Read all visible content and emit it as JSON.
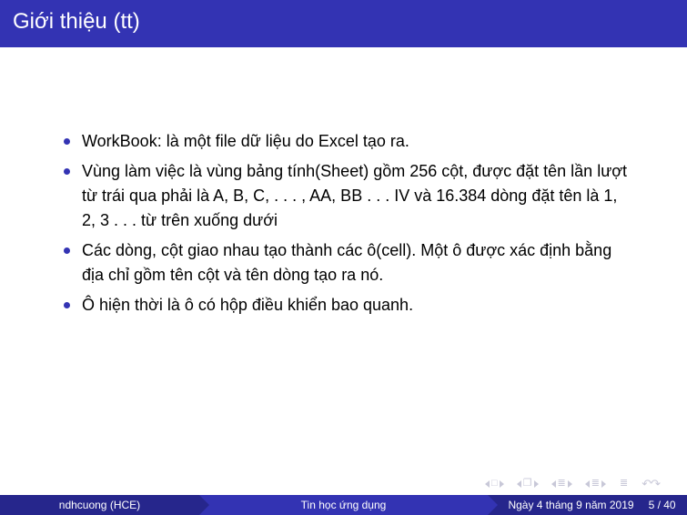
{
  "header": {
    "title": "Giới thiệu (tt)"
  },
  "bullets": {
    "b1": "WorkBook: là một file dữ liệu do Excel tạo ra.",
    "b2": "Vùng làm việc là vùng bảng tính(Sheet) gồm 256 cột, được đặt tên lần lượt từ trái qua phải là A, B, C, . . . , AA, BB . . . IV và 16.384 dòng đặt tên là 1, 2, 3 . . . từ trên xuống dưới",
    "b3": "Các dòng, cột giao nhau tạo thành các ô(cell). Một ô được xác định bằng địa chỉ gồm tên cột và tên dòng tạo ra nó.",
    "b4": "Ô hiện thời là ô có hộp điều khiển bao quanh."
  },
  "nav": {
    "frame_sym": "□",
    "section_sym": "❐",
    "sub_sym": "≣",
    "end_sym": "≣",
    "reload_sym": "↶↷"
  },
  "footer": {
    "author": "ndhcuong (HCE)",
    "title": "Tin học ứng dụng",
    "date": "Ngày 4 tháng 9 năm 2019",
    "page": "5 / 40"
  }
}
